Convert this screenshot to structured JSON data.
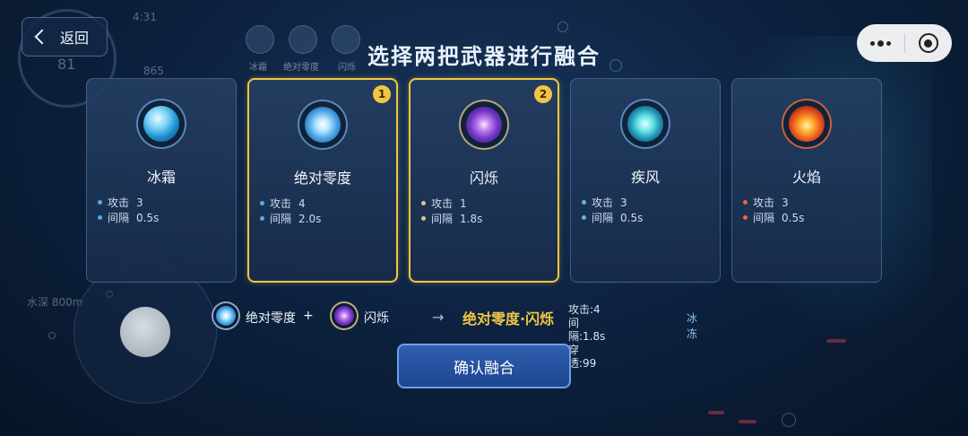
{
  "header": {
    "back_label": "返回",
    "title": "选择两把武器进行融合"
  },
  "background": {
    "timer": "4:31",
    "score": "81",
    "gems": "865",
    "depth": "水深 800m",
    "hud_weapons": [
      "冰霜",
      "绝对零度",
      "闪烁"
    ]
  },
  "colors": {
    "selected_border": "#f1c644",
    "result_text": "#f1c644",
    "confirm_bg": "#2552a0"
  },
  "weapons": [
    {
      "name": "冰霜",
      "icon": "ice-orb-icon",
      "attack_label": "攻击",
      "attack": "3",
      "interval_label": "间隔",
      "interval": "0.5s",
      "dot_color": "#5aa8ec",
      "selected": false,
      "badge": ""
    },
    {
      "name": "绝对零度",
      "icon": "zero-orb-icon",
      "attack_label": "攻击",
      "attack": "4",
      "interval_label": "间隔",
      "interval": "2.0s",
      "dot_color": "#5aa8ec",
      "selected": true,
      "badge": "1"
    },
    {
      "name": "闪烁",
      "icon": "flash-orb-icon",
      "attack_label": "攻击",
      "attack": "1",
      "interval_label": "间隔",
      "interval": "1.8s",
      "dot_color": "#d8c98a",
      "selected": true,
      "badge": "2"
    },
    {
      "name": "疾风",
      "icon": "wind-orb-icon",
      "attack_label": "攻击",
      "attack": "3",
      "interval_label": "间隔",
      "interval": "0.5s",
      "dot_color": "#6ab2e8",
      "selected": false,
      "badge": ""
    },
    {
      "name": "火焰",
      "icon": "fire-orb-icon",
      "attack_label": "攻击",
      "attack": "3",
      "interval_label": "间隔",
      "interval": "0.5s",
      "dot_color": "#e86a3c",
      "selected": false,
      "badge": ""
    }
  ],
  "fusion": {
    "first": "绝对零度",
    "plus": "+",
    "second": "闪烁",
    "arrow": "→",
    "result": "绝对零度·闪烁",
    "stats": [
      "攻击:4",
      "间隔:1.8s",
      "穿透:99"
    ],
    "effect": "冰冻"
  },
  "confirm_label": "确认融合"
}
